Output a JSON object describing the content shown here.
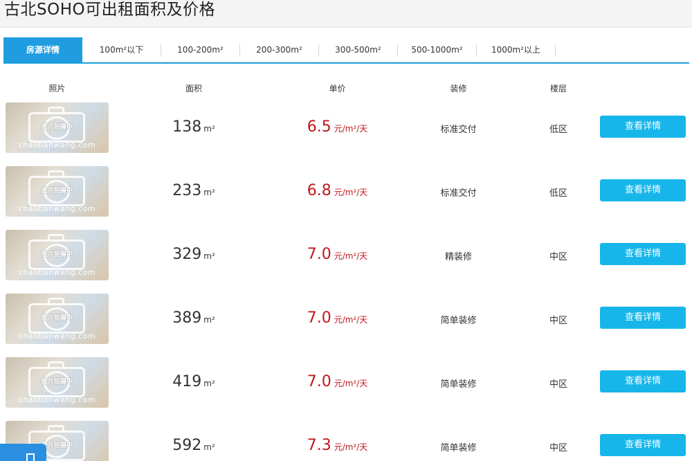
{
  "page": {
    "title": "古北SOHO可出租面积及价格"
  },
  "tabs": [
    {
      "label": "房源详情",
      "active": true
    },
    {
      "label": "100m²以下"
    },
    {
      "label": "100-200m²"
    },
    {
      "label": "200-300m²"
    },
    {
      "label": "300-500m²"
    },
    {
      "label": "500-1000m²"
    },
    {
      "label": "1000m²以上"
    }
  ],
  "table": {
    "headers": {
      "photo": "照片",
      "area": "面积",
      "price": "单价",
      "decoration": "装修",
      "floor": "楼层"
    },
    "placeholder_text": "图片拍摄中",
    "watermark": "chaobanwang.com",
    "area_unit": "m²",
    "price_unit": "元/m²/天",
    "detail_label": "查看详情",
    "rows": [
      {
        "area": "138",
        "price": "6.5",
        "decoration": "标准交付",
        "floor": "低区"
      },
      {
        "area": "233",
        "price": "6.8",
        "decoration": "标准交付",
        "floor": "低区"
      },
      {
        "area": "329",
        "price": "7.0",
        "decoration": "精装修",
        "floor": "中区"
      },
      {
        "area": "389",
        "price": "7.0",
        "decoration": "简单装修",
        "floor": "中区"
      },
      {
        "area": "419",
        "price": "7.0",
        "decoration": "简单装修",
        "floor": "中区"
      },
      {
        "area": "592",
        "price": "7.3",
        "decoration": "简单装修",
        "floor": "中区"
      }
    ]
  },
  "colors": {
    "accent": "#1f9de0",
    "price": "#c0171c",
    "button": "#17b6ea"
  },
  "icons": {
    "photo_placeholder": "camera-icon",
    "corner_widget": "window-icon"
  }
}
